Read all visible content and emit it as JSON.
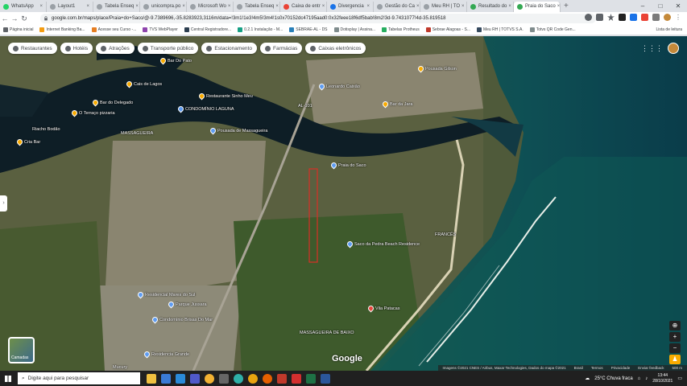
{
  "browser": {
    "tabs": [
      {
        "label": "WhatsApp",
        "color": "#25d366"
      },
      {
        "label": "Layout1",
        "color": "#9aa0a6"
      },
      {
        "label": "Tabela Enseq",
        "color": "#9aa0a6"
      },
      {
        "label": "unicompra.po",
        "color": "#9aa0a6"
      },
      {
        "label": "Microsoft Wo",
        "color": "#9aa0a6"
      },
      {
        "label": "Tabela Enseq",
        "color": "#9aa0a6"
      },
      {
        "label": "Caixa de entr",
        "color": "#ea4335"
      },
      {
        "label": "Divergencia",
        "color": "#1a73e8"
      },
      {
        "label": "Gestão do Ca",
        "color": "#9aa0a6"
      },
      {
        "label": "Meu RH | TO",
        "color": "#9aa0a6"
      },
      {
        "label": "Resultado do",
        "color": "#34a853"
      },
      {
        "label": "Praia do Saco",
        "color": "#34a853",
        "active": true
      }
    ],
    "url": "google.com.br/maps/place/Praia+do+Saco/@-9.7389696,-35.8283923,3116m/data=!3m1!1e3!4m5!3m4!1s0x70152dc47195aad0:0x32feee18f6df5bab!8m2!3d-9.7431077!4d-35.819518",
    "bookmarks": [
      "Página inicial",
      "Internet Banking Ba...",
      "Acesse seu Curso -...",
      "TVS WebPlayer",
      "Central Registradore...",
      "0.2.1 Instalação - M...",
      "SEBRAE-AL - DS",
      "Dotisplay | Assina...",
      "Tabelas Protheus",
      "Sebrae Alagoas - S...",
      "Meu RH | TOTVS S.A.",
      "Totvs QR Code Gen..."
    ],
    "bookmarks_right": "Lista de leitura"
  },
  "map": {
    "chips": [
      "Restaurantes",
      "Hotéis",
      "Atrações",
      "Transporte público",
      "Estacionamento",
      "Farmácias",
      "Caixas eletrônicos"
    ],
    "labels": [
      "Bar Do Pato",
      "Cais de Lagos",
      "Bar do Delegado",
      "O Terraço pizzaria",
      "Riacho Bodão",
      "Cria Bar",
      "CONDOMÍNIO LAGUNA",
      "Restaurante Sinho Meu",
      "Leonardo Caixão",
      "Bar da Jara",
      "Pousada Gilson",
      "MASSAGUEIRA",
      "Pousada de Massagueira",
      "Praia do Saco",
      "Saco da Pedra Beach Residence",
      "FRANCÊS",
      "Residencial Mares do Sul",
      "Parque Jussara",
      "Condomínio Brisas Do Mar",
      "Residencia Grande",
      "Vila Patacas",
      "MASSAGUEIRA DE BAIXO",
      "Mucury",
      "AL-101"
    ],
    "google_logo": "Google",
    "layers_label": "Camadas",
    "footer": [
      "Imagens ©2021 CNES / Airbus, Maxar Technologies, Dados do mapa ©2021",
      "Brasil",
      "Termos",
      "Privacidade",
      "Enviar feedback",
      "500 m"
    ]
  },
  "taskbar": {
    "search_placeholder": "Digite aqui para pesquisar",
    "weather": "25°C  Chuva fraca",
    "time": "13:44",
    "date": "28/10/2021"
  }
}
